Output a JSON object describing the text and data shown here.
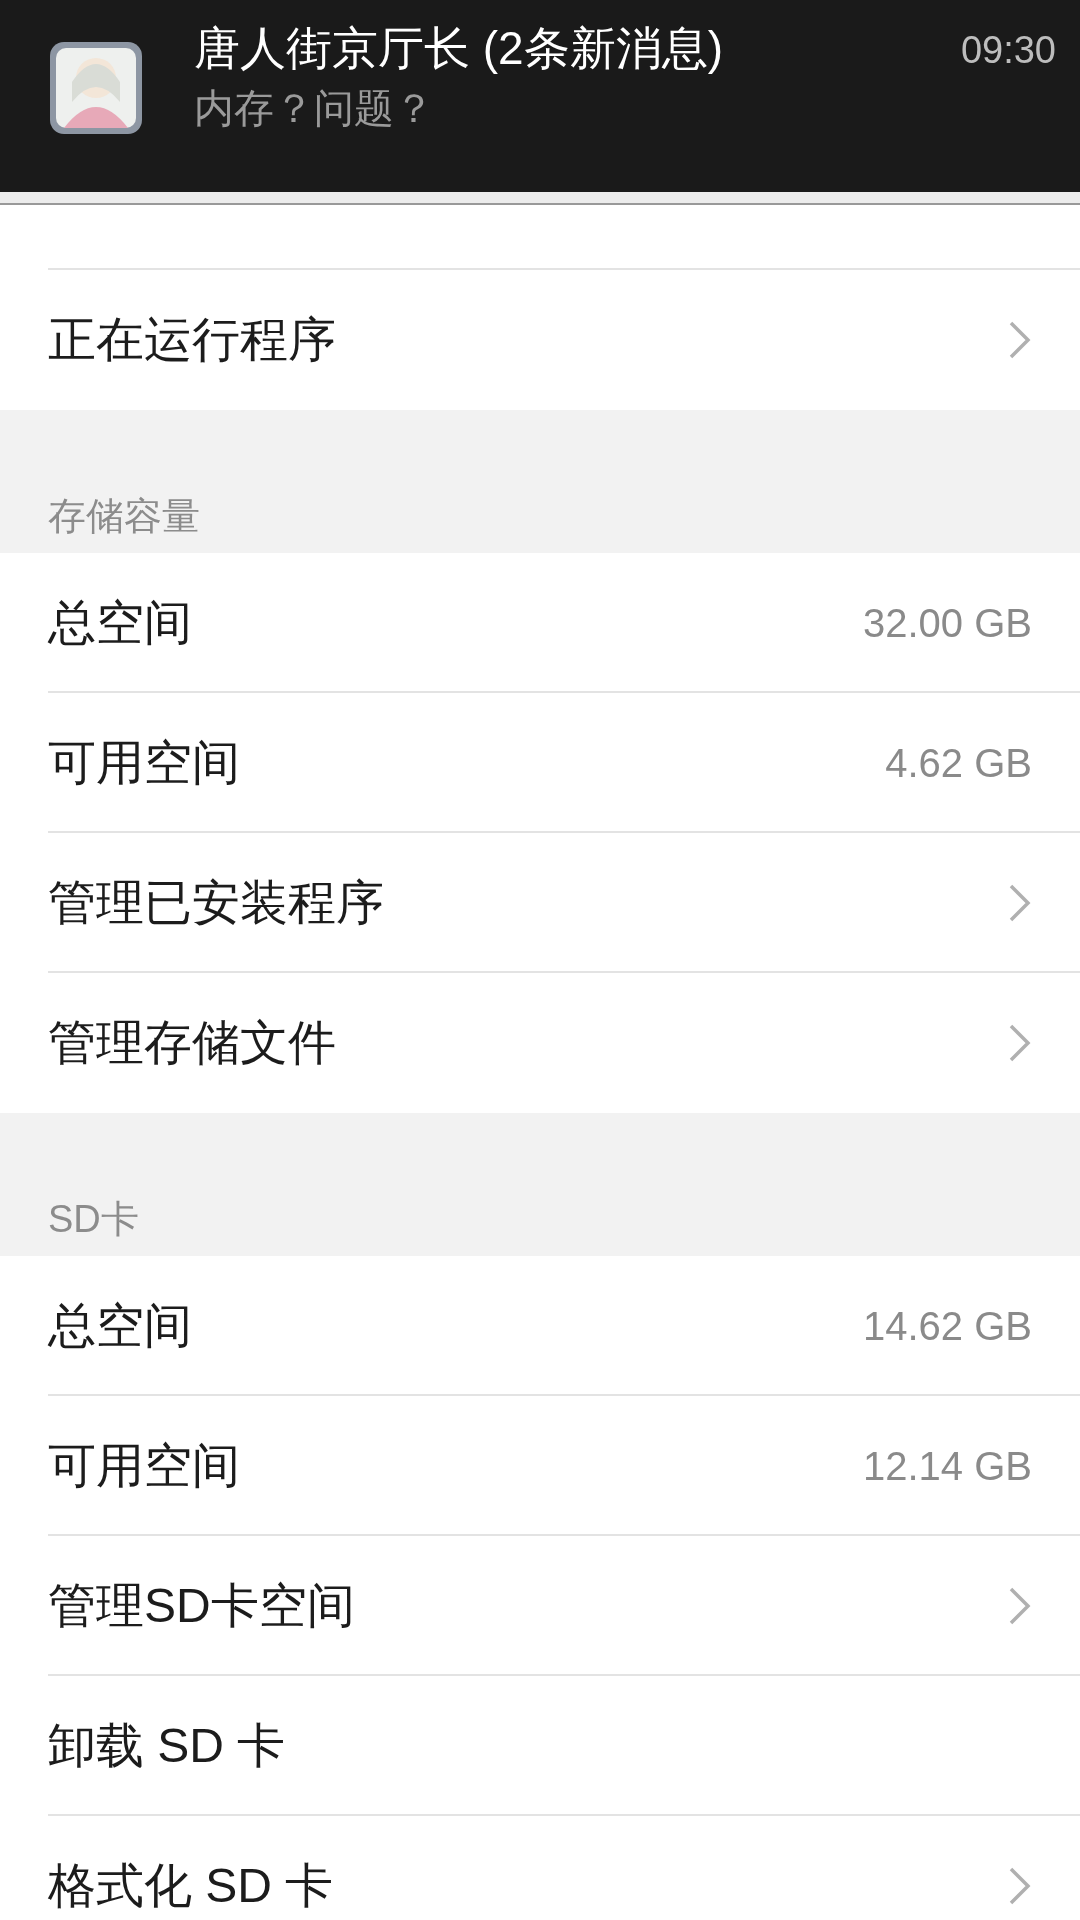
{
  "notification": {
    "title": "唐人街京厅长 (2条新消息)",
    "message": "内存？问题？",
    "time": "09:30"
  },
  "sections": [
    {
      "rows": [
        {
          "kind": "link",
          "label": "正在运行程序"
        }
      ]
    },
    {
      "header": "存储容量",
      "rows": [
        {
          "kind": "value",
          "label": "总空间",
          "value": "32.00 GB"
        },
        {
          "kind": "value",
          "label": "可用空间",
          "value": "4.62 GB"
        },
        {
          "kind": "link",
          "label": "管理已安装程序"
        },
        {
          "kind": "link",
          "label": "管理存储文件"
        }
      ]
    },
    {
      "header": "SD卡",
      "rows": [
        {
          "kind": "value",
          "label": "总空间",
          "value": "14.62 GB"
        },
        {
          "kind": "value",
          "label": "可用空间",
          "value": "12.14 GB"
        },
        {
          "kind": "link",
          "label": "管理SD卡空间"
        },
        {
          "kind": "plain",
          "label": "卸载 SD 卡"
        },
        {
          "kind": "link",
          "label": "格式化 SD 卡"
        }
      ]
    }
  ]
}
